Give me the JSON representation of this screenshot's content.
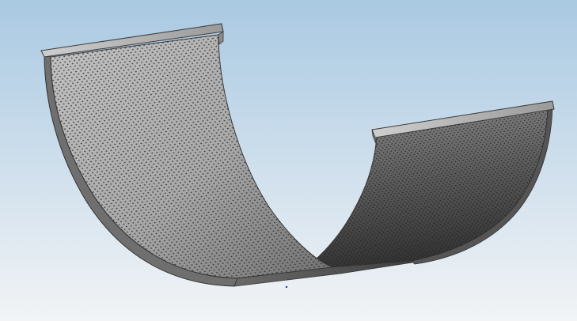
{
  "viewport": {
    "background_top": "#a9c9e2",
    "background_bottom": "#f2f4f6"
  },
  "model": {
    "part_name": "perforated-curved-screen",
    "surface_light": "#b6b6b6",
    "surface_mid": "#8e8e8e",
    "surface_dark": "#3f3f3f",
    "edge_color": "#3a3a3a",
    "flange_color": "#9a9a9a",
    "hole_color": "#2a2a2a",
    "hole_pattern": "staggered-slot-perforation"
  },
  "origin_marker": {
    "icon": "origin-point-icon",
    "color": "#2233aa"
  }
}
